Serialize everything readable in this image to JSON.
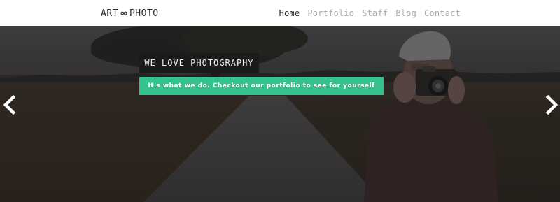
{
  "brand": {
    "left": "ART",
    "right": "PHOTO",
    "mark_icon": "infinity-icon"
  },
  "nav": {
    "items": [
      {
        "label": "Home",
        "active": true
      },
      {
        "label": "Portfolio",
        "active": false
      },
      {
        "label": "Staff",
        "active": false
      },
      {
        "label": "Blog",
        "active": false
      },
      {
        "label": "Contact",
        "active": false
      }
    ]
  },
  "hero": {
    "headline": "WE LOVE PHOTOGRAPHY",
    "tagline": "It's what we do. Checkout our portfolio to see for yourself",
    "prev_icon": "chevron-left-icon",
    "next_icon": "chevron-right-icon"
  },
  "colors": {
    "accent": "#33c28e",
    "headline_bg": "#1c1a1a",
    "nav_active": "#222222",
    "nav_inactive": "#a8a8a8"
  }
}
